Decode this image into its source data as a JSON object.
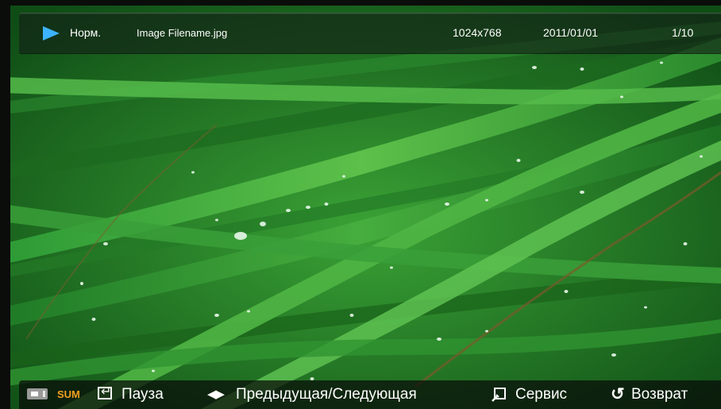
{
  "info_bar": {
    "play_icon": "play-icon",
    "mode": "Норм.",
    "filename": "Image Filename.jpg",
    "resolution": "1024x768",
    "date": "2011/01/01",
    "counter": "1/10"
  },
  "control_bar": {
    "device_icon": "usb-device-icon",
    "sum_label": "SUM",
    "pause": {
      "icon": "enter-icon",
      "label": "Пауза"
    },
    "prev_next": {
      "icon": "left-right-arrows-icon",
      "label": "Предыдущая/Следующая"
    },
    "tools": {
      "icon": "tools-icon",
      "label": "Сервис"
    },
    "return": {
      "icon": "return-icon",
      "label": "Возврат"
    }
  },
  "colors": {
    "accent_play": "#3db3ff",
    "sum_orange": "#f0a020",
    "bar_text": "#ffffff"
  }
}
